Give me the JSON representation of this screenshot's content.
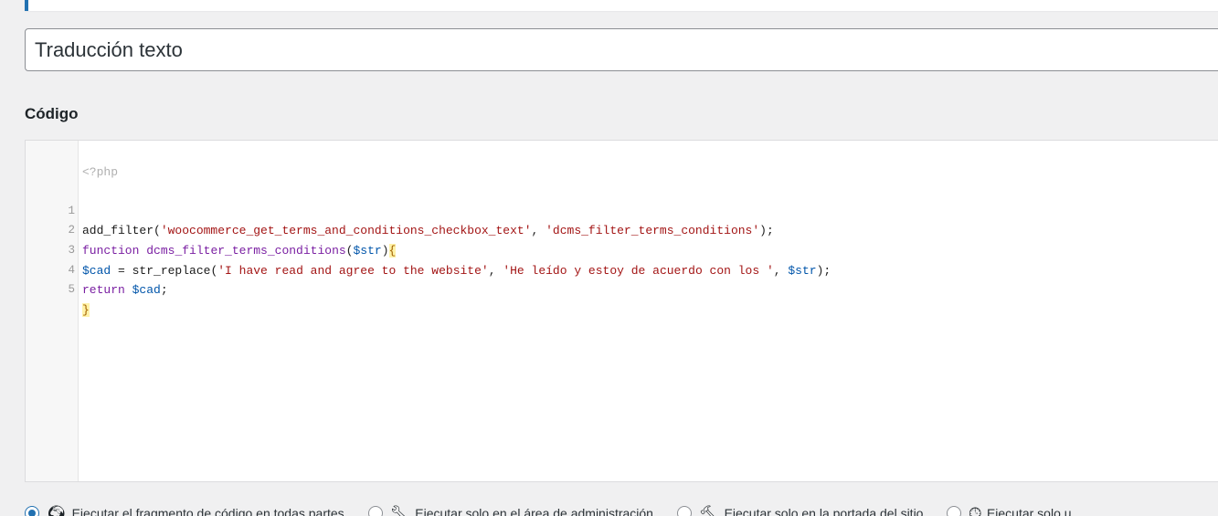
{
  "snippet": {
    "title_value": "Traducción texto"
  },
  "code_section": {
    "label": "Código",
    "php_open": "<?php",
    "line_numbers": [
      "1",
      "2",
      "3",
      "4",
      "5"
    ],
    "lines": [
      "add_filter('woocommerce_get_terms_and_conditions_checkbox_text', 'dcms_filter_terms_conditions');",
      "function dcms_filter_terms_conditions($str){",
      "$cad = str_replace('I have read and agree to the website', 'He leído y estoy de acuerdo con los ', $str);",
      "return $cad;",
      "}"
    ]
  },
  "scope_options": [
    {
      "label": "Ejecutar el fragmento de código en todas partes",
      "icon": "globe-icon",
      "checked": true
    },
    {
      "label": "Ejecutar solo en el área de administración",
      "icon": "wrench-icon",
      "checked": false
    },
    {
      "label": "Ejecutar solo en la portada del sitio",
      "icon": "hammer-icon",
      "checked": false
    },
    {
      "label": "Ejecutar solo u",
      "icon": "clock-icon",
      "checked": false
    }
  ],
  "colors": {
    "accent": "#2271b1",
    "keyword": "#7a1fa2",
    "string": "#a31515",
    "variable": "#0055aa"
  }
}
